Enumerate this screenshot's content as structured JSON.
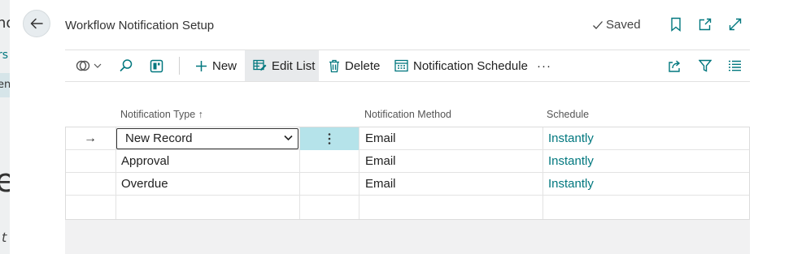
{
  "page": {
    "title": "Workflow Notification Setup",
    "saved_label": "Saved"
  },
  "background": {
    "fragments": [
      "no",
      "rs",
      "en",
      "e",
      "t"
    ]
  },
  "toolbar": {
    "new_label": "New",
    "edit_list_label": "Edit List",
    "delete_label": "Delete",
    "schedule_label": "Notification Schedule",
    "more_label": "···"
  },
  "table": {
    "headers": {
      "type": "Notification Type",
      "sort_indicator": "↑",
      "method": "Notification Method",
      "schedule": "Schedule"
    },
    "rows": [
      {
        "type": "New Record",
        "method": "Email",
        "schedule": "Instantly",
        "selected": true
      },
      {
        "type": "Approval",
        "method": "Email",
        "schedule": "Instantly",
        "selected": false
      },
      {
        "type": "Overdue",
        "method": "Email",
        "schedule": "Instantly",
        "selected": false
      }
    ],
    "row_marker": "→"
  },
  "colors": {
    "accent": "#00777e",
    "selected_cell": "#b5e3ea"
  }
}
